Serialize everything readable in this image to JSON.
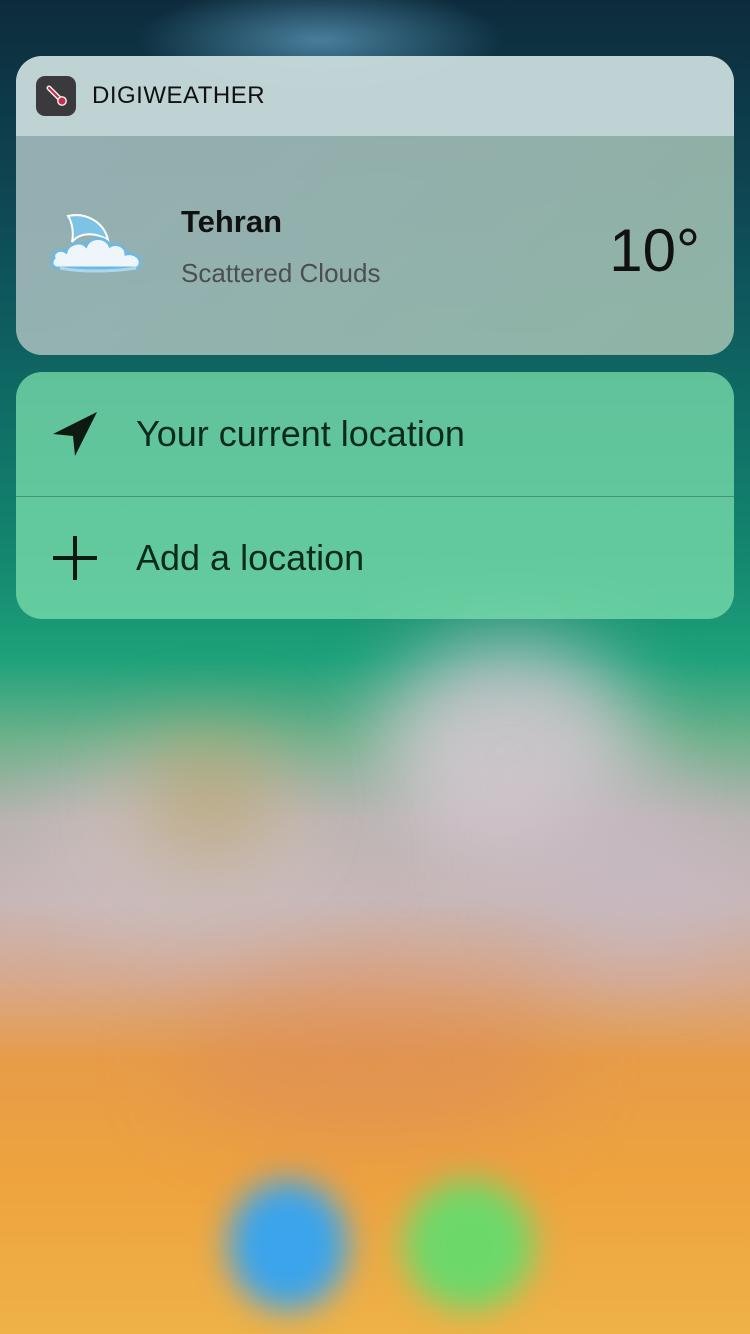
{
  "widget": {
    "app_name": "DIGIWEATHER",
    "app_icon": "thermometer-icon",
    "city": "Tehran",
    "condition": "Scattered Clouds",
    "temperature": "10°",
    "weather_icon": "cloud-moon-icon"
  },
  "quick_actions": [
    {
      "label": "Your current location",
      "icon": "location-arrow-icon"
    },
    {
      "label": "Add a location",
      "icon": "plus-icon"
    }
  ],
  "colors": {
    "widget_header": "#D2E1E4",
    "actions_background": "#78DCAA",
    "dock_blue": "#3AA4EC",
    "dock_green": "#6DD86A"
  }
}
